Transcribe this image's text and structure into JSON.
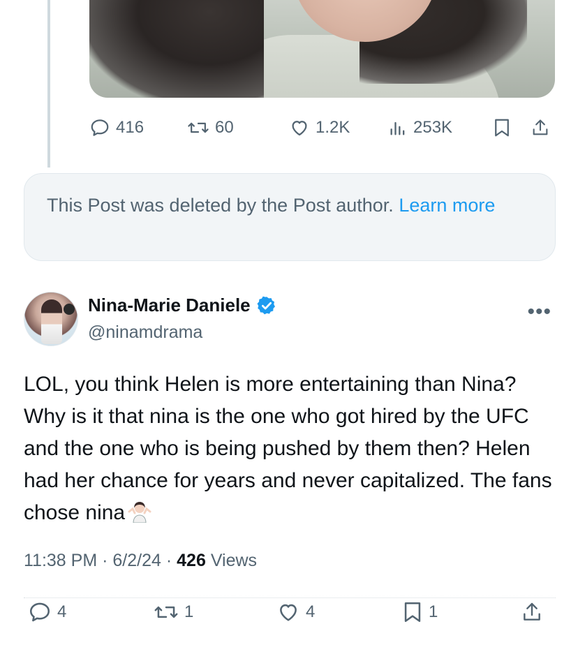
{
  "quoted_post": {
    "stats": {
      "replies": "416",
      "reposts": "60",
      "likes": "1.2K",
      "views": "253K"
    }
  },
  "deleted_notice": {
    "text": "This Post was deleted by the Post author.",
    "link": "Learn more"
  },
  "tweet": {
    "author_name": "Nina-Marie Daniele",
    "handle": "@ninamdrama",
    "text": "LOL, you think Helen is more entertaining than Nina? Why is it that nina is the one who got hired by the UFC and the one who is being pushed by them then? Helen had her chance for years and never capitalized. The fans chose nina",
    "emoji": "person-shrugging",
    "time": "11:38 PM",
    "date": "6/2/24",
    "views_count": "426",
    "views_label": "Views",
    "sep": "·"
  },
  "tweet_actions": {
    "replies": "4",
    "reposts": "1",
    "likes": "4",
    "bookmarks": "1"
  },
  "colors": {
    "text_primary": "#0f1419",
    "text_secondary": "#536471",
    "link": "#1d9bf0",
    "verified": "#1d9bf0",
    "notice_bg": "#f2f5f7"
  }
}
